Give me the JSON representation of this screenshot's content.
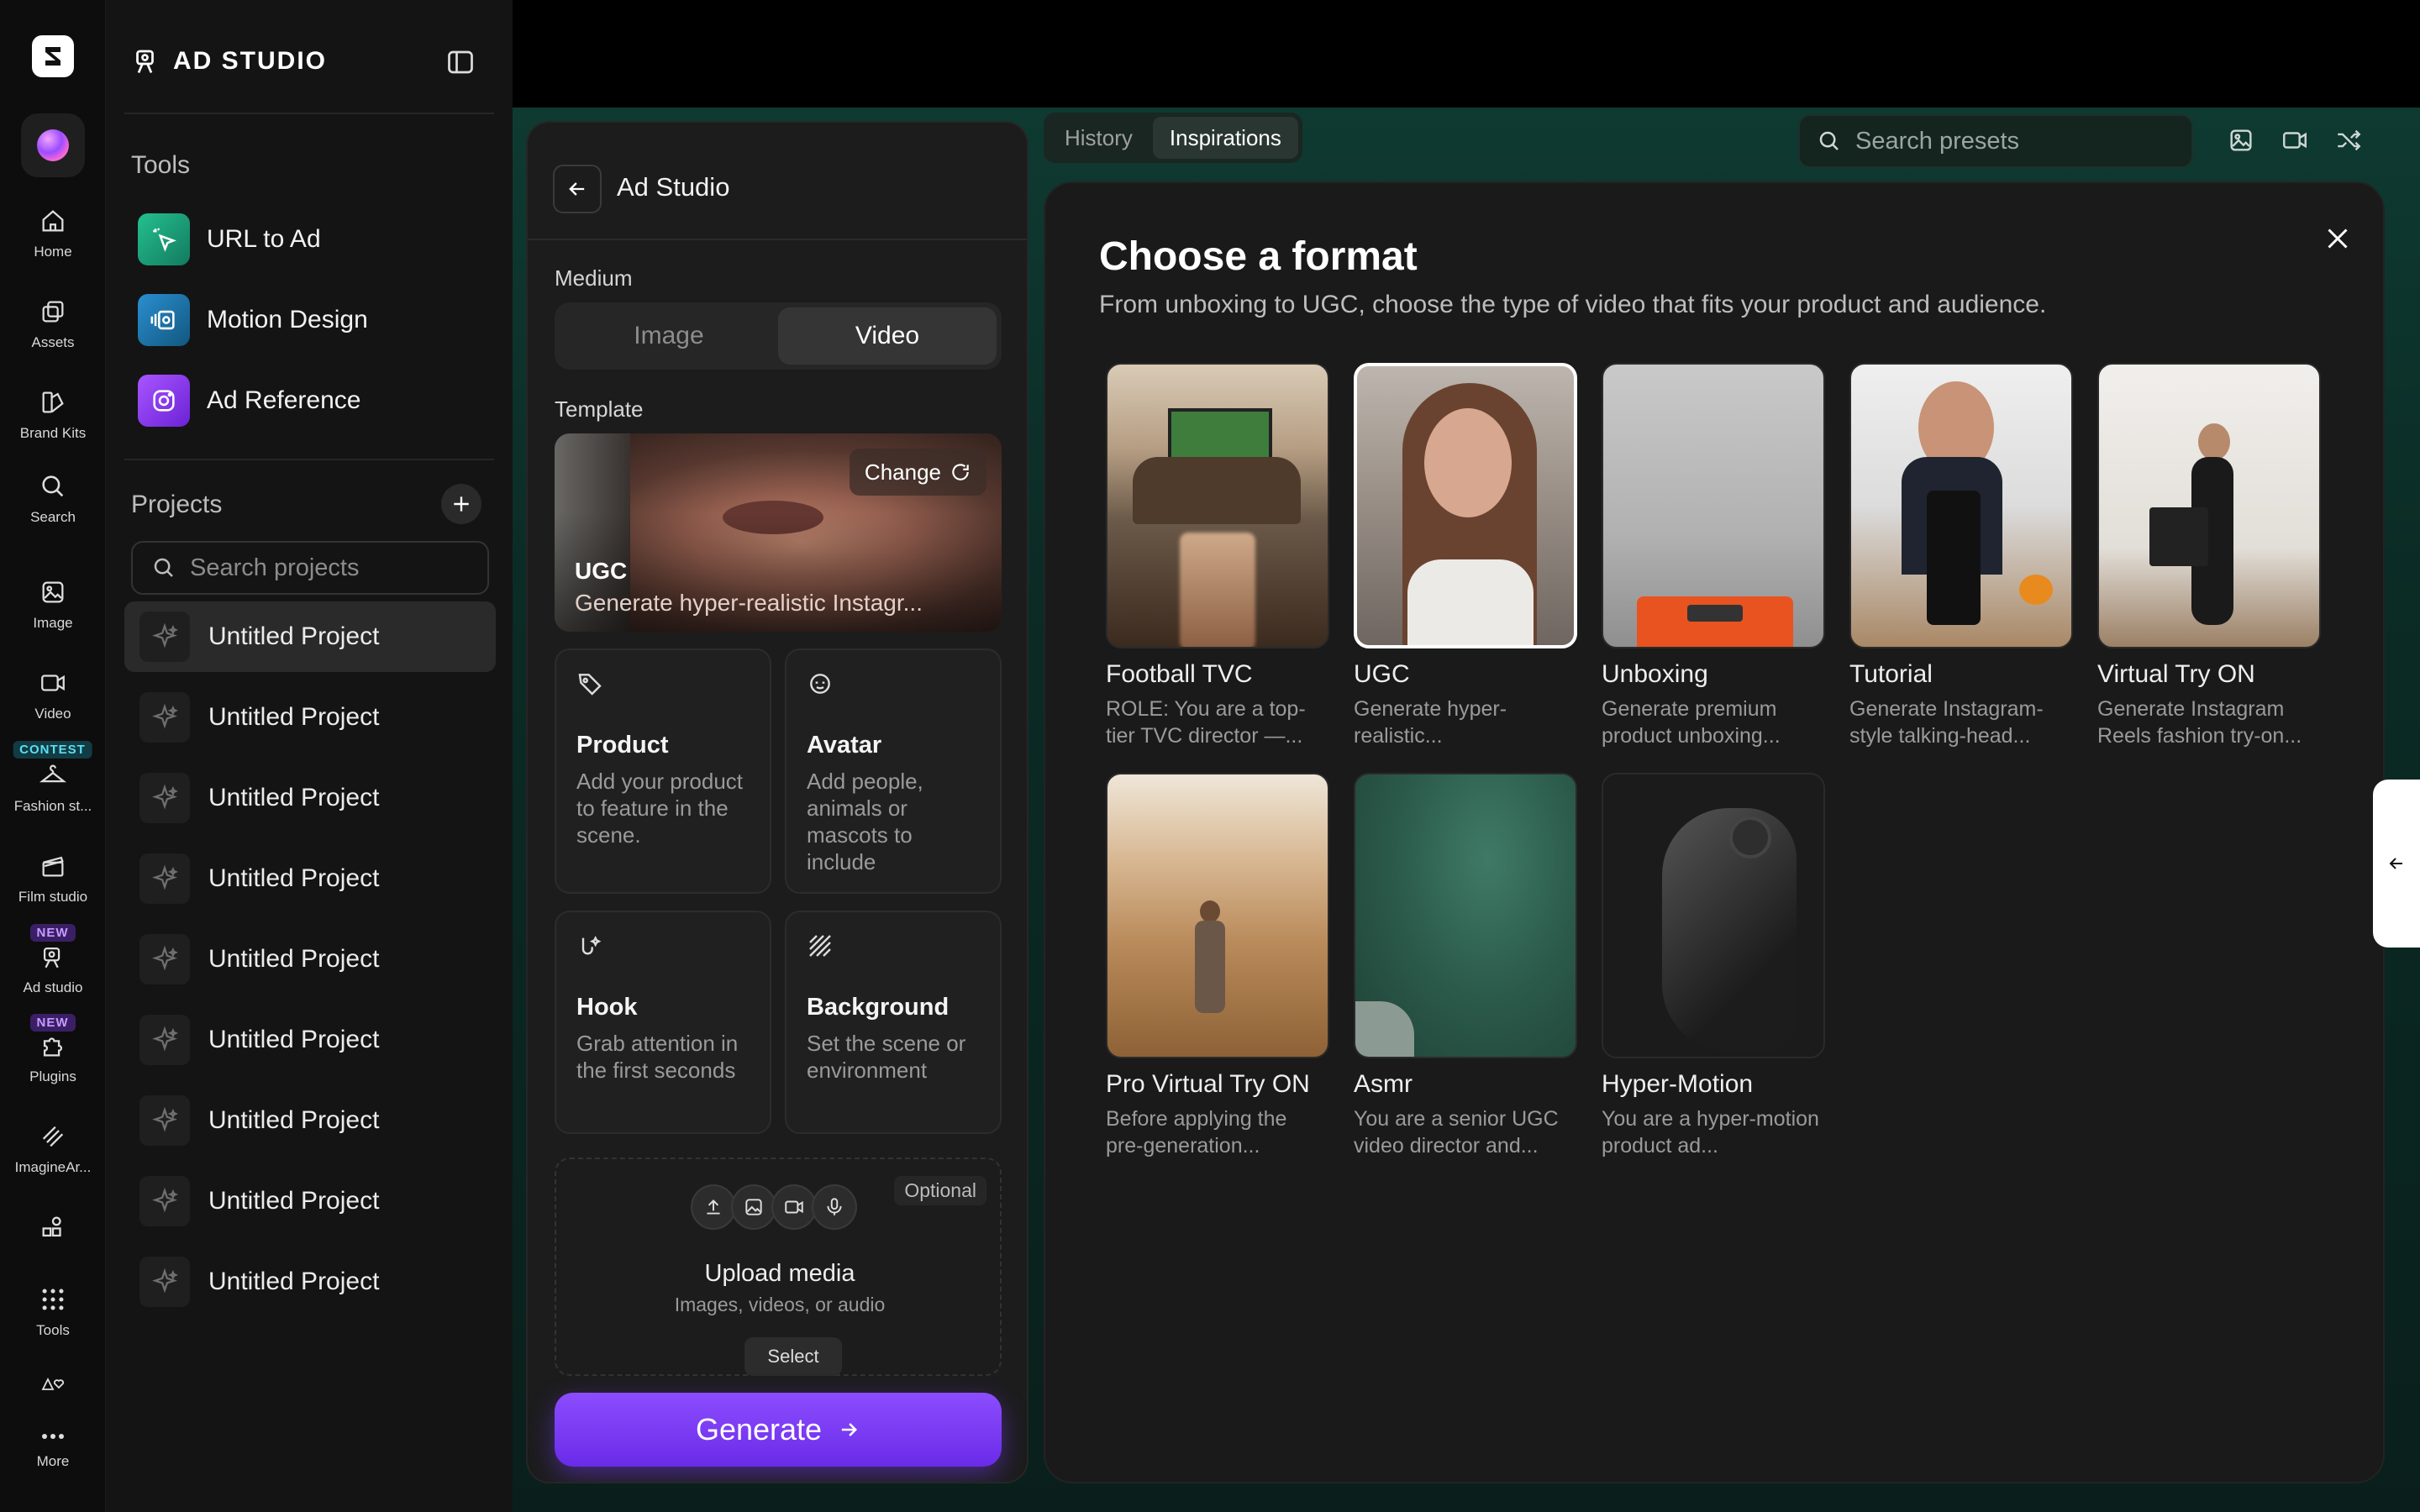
{
  "rail": {
    "items": [
      {
        "label": "Home"
      },
      {
        "label": "Assets"
      },
      {
        "label": "Brand Kits"
      },
      {
        "label": "Search"
      },
      {
        "label": "Image"
      },
      {
        "label": "Video",
        "badge": "CONTEST"
      },
      {
        "label": "Fashion st...",
        "badge": ""
      },
      {
        "label": "Film studio",
        "badge": "NEW"
      },
      {
        "label": "Ad studio",
        "badge": "NEW"
      },
      {
        "label": "Plugins"
      },
      {
        "label": "ImagineAr..."
      },
      {
        "label": ""
      },
      {
        "label": "Tools"
      },
      {
        "label": ""
      },
      {
        "label": "More"
      }
    ]
  },
  "sidebar": {
    "title": "AD STUDIO",
    "tools_heading": "Tools",
    "tools": [
      {
        "label": "URL to Ad",
        "color": "#1f9e7a"
      },
      {
        "label": "Motion Design",
        "color": "#1b6fa8"
      },
      {
        "label": "Ad Reference",
        "color": "#8a3df0"
      }
    ],
    "projects_heading": "Projects",
    "search_placeholder": "Search projects",
    "projects": [
      "Untitled Project",
      "Untitled Project",
      "Untitled Project",
      "Untitled Project",
      "Untitled Project",
      "Untitled Project",
      "Untitled Project",
      "Untitled Project",
      "Untitled Project"
    ]
  },
  "panel": {
    "title": "Ad Studio",
    "medium_label": "Medium",
    "medium_options": [
      "Image",
      "Video"
    ],
    "medium_selected": "Video",
    "template_label": "Template",
    "template": {
      "change_label": "Change",
      "name": "UGC",
      "description": "Generate hyper-realistic Instagr..."
    },
    "options": [
      {
        "title": "Product",
        "description": "Add your product to feature in the scene.",
        "icon": "tag-icon"
      },
      {
        "title": "Avatar",
        "description": "Add people, animals or mascots to include",
        "icon": "face-icon"
      },
      {
        "title": "Hook",
        "description": "Grab attention in the first seconds",
        "icon": "hook-icon"
      },
      {
        "title": "Background",
        "description": "Set the scene or environment",
        "icon": "hatch-icon"
      }
    ],
    "upload": {
      "optional_label": "Optional",
      "title": "Upload media",
      "subtitle": "Images, videos, or audio",
      "select_label": "Select"
    },
    "generate_label": "Generate"
  },
  "topbar": {
    "tabs": [
      "History",
      "Inspirations"
    ],
    "active_tab": "Inspirations",
    "search_placeholder": "Search presets"
  },
  "modal": {
    "title": "Choose a format",
    "subtitle": "From unboxing to UGC, choose the type of video that fits your product and audience.",
    "formats": [
      {
        "name": "Football TVC",
        "description": "ROLE: You are a top-tier TVC director —...",
        "selected": false
      },
      {
        "name": "UGC",
        "description": "Generate hyper-realistic...",
        "selected": true
      },
      {
        "name": "Unboxing",
        "description": "Generate premium product unboxing...",
        "selected": false
      },
      {
        "name": "Tutorial",
        "description": "Generate Instagram-style talking-head...",
        "selected": false
      },
      {
        "name": "Virtual Try ON",
        "description": "Generate Instagram Reels fashion try-on...",
        "selected": false
      },
      {
        "name": "Pro Virtual Try ON",
        "description": "Before applying the pre-generation...",
        "selected": false
      },
      {
        "name": "Asmr",
        "description": "You are a senior UGC video director and...",
        "selected": false
      },
      {
        "name": "Hyper-Motion",
        "description": "You are a hyper-motion product ad...",
        "selected": false
      }
    ]
  },
  "colors": {
    "accent": "#7b3cff",
    "background": "#0d0d0d",
    "main_gradient": "#0e3a31"
  }
}
